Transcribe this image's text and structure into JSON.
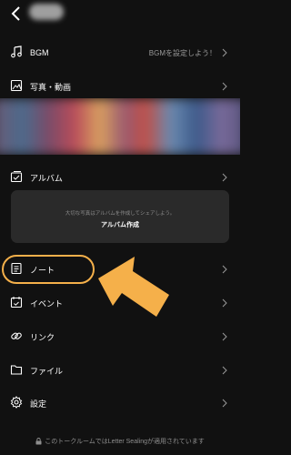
{
  "header": {
    "back_icon": "chevron-left-icon"
  },
  "menu": {
    "bgm": {
      "label": "BGM",
      "value": "BGMを設定しよう！",
      "icon": "music-note-icon"
    },
    "photos": {
      "label": "写真・動画",
      "icon": "photo-icon"
    },
    "album": {
      "label": "アルバム",
      "icon": "album-icon"
    },
    "album_card": {
      "description": "大切な写真はアルバムを作成してシェアしよう。",
      "button": "アルバム作成"
    },
    "note": {
      "label": "ノート",
      "icon": "note-icon"
    },
    "event": {
      "label": "イベント",
      "icon": "calendar-icon"
    },
    "link": {
      "label": "リンク",
      "icon": "link-icon"
    },
    "file": {
      "label": "ファイル",
      "icon": "folder-icon"
    },
    "settings": {
      "label": "設定",
      "icon": "gear-icon"
    }
  },
  "footer": {
    "text": "このトークルームではLetter Sealingが適用されています",
    "icon": "lock-icon"
  },
  "colors": {
    "background": "#111111",
    "card": "#2a2a2a",
    "highlight": "#f5b04a",
    "secondary_text": "#9a9a9a"
  }
}
